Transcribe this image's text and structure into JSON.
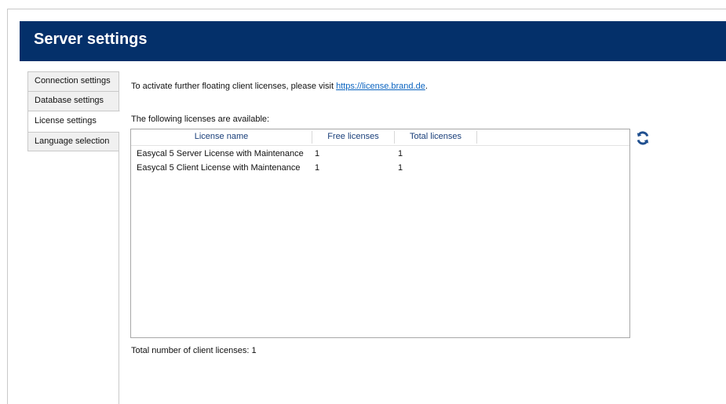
{
  "header": {
    "title": "Server settings"
  },
  "tabs": [
    {
      "label": "Connection settings",
      "active": false
    },
    {
      "label": "Database settings",
      "active": false
    },
    {
      "label": "License settings",
      "active": true
    },
    {
      "label": "Language selection",
      "active": false
    }
  ],
  "license_page": {
    "info_prefix": "To activate further floating client licenses, please visit ",
    "info_link": "https://license.brand.de",
    "info_suffix": ".",
    "available_label": "The following licenses are available:",
    "refresh_icon": "refresh-icon",
    "table": {
      "columns": [
        "License name",
        "Free licenses",
        "Total licenses"
      ],
      "rows": [
        {
          "name": "Easycal 5 Server License with Maintenance",
          "free": "1",
          "total": "1"
        },
        {
          "name": "Easycal 5 Client License with Maintenance",
          "free": "1",
          "total": "1"
        }
      ]
    },
    "total_label": "Total number of client licenses: 1"
  },
  "colors": {
    "header_background": "#04306a",
    "link": "#0b64c0",
    "refresh_icon": "#1f4f8f"
  }
}
